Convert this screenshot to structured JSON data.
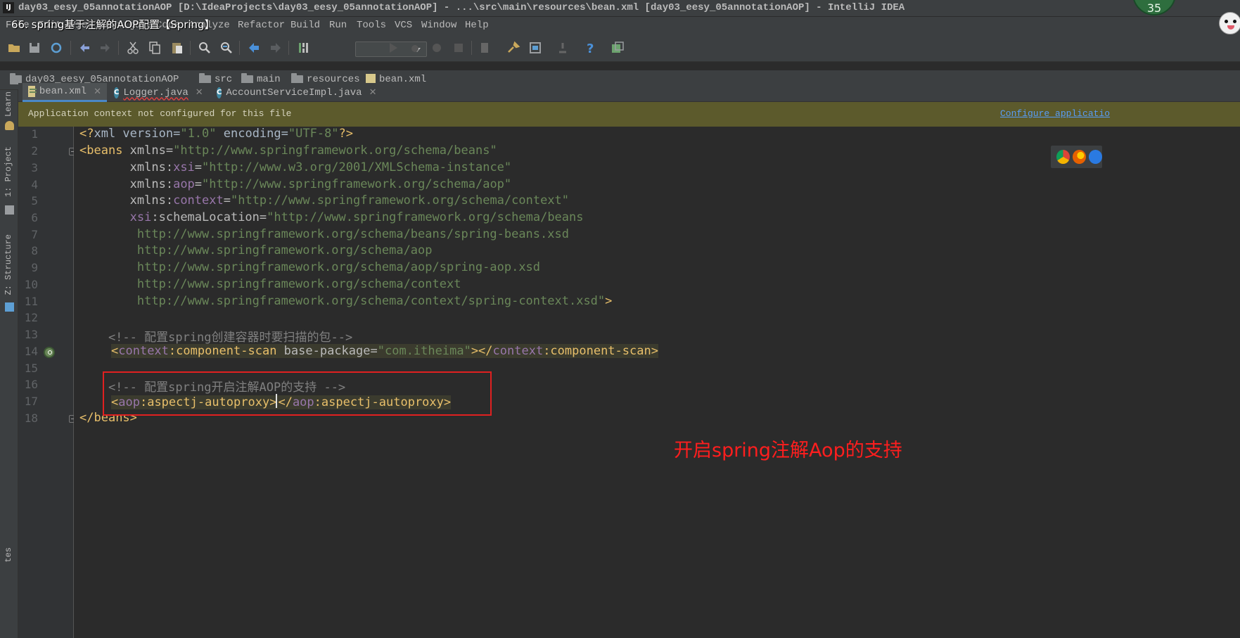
{
  "window": {
    "title": "day03_eesy_05annotationAOP [D:\\IdeaProjects\\day03_eesy_05annotationAOP] - ...\\src\\main\\resources\\bean.xml [day03_eesy_05annotationAOP] - IntelliJ IDEA",
    "app_icon": "IJ",
    "badge_count": "35"
  },
  "overlay": {
    "caption": "66. spring基于注解的AOP配置【Spring】",
    "annotation": "开启spring注解Aop的支持"
  },
  "menu": [
    "File",
    "Edit",
    "View",
    "Navigate",
    "Code",
    "Analyze",
    "Refactor",
    "Build",
    "Run",
    "Tools",
    "VCS",
    "Window",
    "Help"
  ],
  "breadcrumb": [
    "day03_eesy_05annotationAOP",
    "src",
    "main",
    "resources",
    "bean.xml"
  ],
  "side_tabs": [
    "Learn",
    "1: Project",
    "Z: Structure",
    "tes"
  ],
  "tabs": [
    {
      "label": "bean.xml",
      "type": "xml",
      "active": true
    },
    {
      "label": "Logger.java",
      "type": "class",
      "active": false
    },
    {
      "label": "AccountServiceImpl.java",
      "type": "class",
      "active": false
    }
  ],
  "banner": {
    "message": "Application context not configured for this file",
    "link": "Configure applicatio"
  },
  "line_numbers": [
    "1",
    "2",
    "3",
    "4",
    "5",
    "6",
    "7",
    "8",
    "9",
    "10",
    "11",
    "12",
    "13",
    "14",
    "15",
    "16",
    "17",
    "18"
  ],
  "code": {
    "l1": {
      "a": "<?",
      "b": "xml version",
      "c": "=",
      "d": "\"1.0\"",
      "e": " encoding",
      "f": "=",
      "g": "\"UTF-8\"",
      "h": "?>"
    },
    "l2": {
      "a": "<",
      "b": "beans",
      "c": " xmlns",
      "d": "=",
      "e": "\"http://www.springframework.org/schema/beans\""
    },
    "l3": {
      "a": "       xmlns",
      "b": ":",
      "c": "xsi",
      "d": "=",
      "e": "\"http://www.w3.org/2001/XMLSchema-instance\""
    },
    "l4": {
      "a": "       xmlns",
      "b": ":",
      "c": "aop",
      "d": "=",
      "e": "\"http://www.springframework.org/schema/aop\""
    },
    "l5": {
      "a": "       xmlns",
      "b": ":",
      "c": "context",
      "d": "=",
      "e": "\"http://www.springframework.org/schema/context\""
    },
    "l6": {
      "a": "       ",
      "b": "xsi",
      "c": ":schemaLocation",
      "d": "=",
      "e": "\"http://www.springframework.org/schema/beans"
    },
    "l7": "        http://www.springframework.org/schema/beans/spring-beans.xsd",
    "l8": "        http://www.springframework.org/schema/aop",
    "l9": "        http://www.springframework.org/schema/aop/spring-aop.xsd",
    "l10": "        http://www.springframework.org/schema/context",
    "l11": {
      "a": "        http://www.springframework.org/schema/context/spring-context.xsd\"",
      "b": ">"
    },
    "l13": "    <!-- 配置spring创建容器时要扫描的包-->",
    "l14": {
      "a": "<",
      "b": "context",
      "c": ":component-scan",
      "d": " base-package",
      "e": "=",
      "f": "\"com.itheima\"",
      "g": "></",
      "h": "context",
      "i": ":component-scan",
      "j": ">"
    },
    "l16": "    <!-- 配置spring开启注解AOP的支持 -->",
    "l17": {
      "a": "<",
      "b": "aop",
      "c": ":aspectj-autoproxy",
      "d": ">",
      "e": "</",
      "f": "aop",
      "g": ":aspectj-autoproxy",
      "h": ">"
    },
    "l18": {
      "a": "</",
      "b": "beans",
      "c": ">"
    }
  },
  "colors": {
    "tag": "#e8bf6a",
    "namespace": "#9876aa",
    "string": "#6a8759",
    "comment": "#808080",
    "annotation_red": "#ff1e1e",
    "banner": "#5c5a2c"
  }
}
